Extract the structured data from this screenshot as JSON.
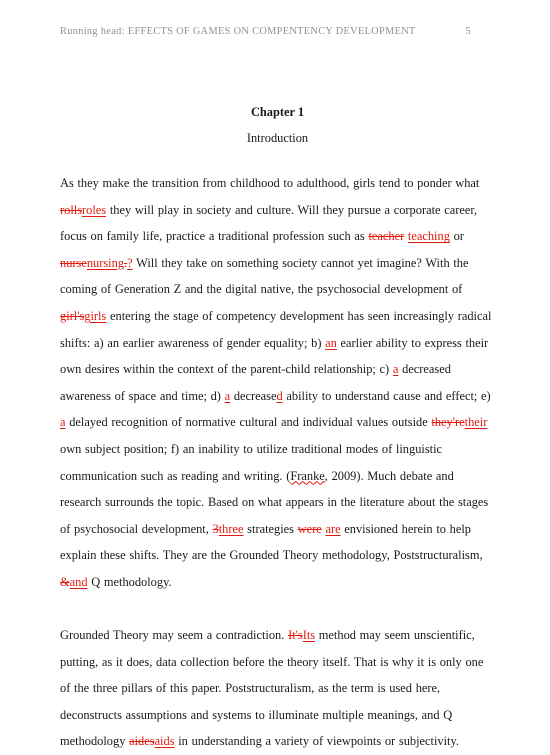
{
  "document": {
    "running_head": "Running head: EFFECTS OF GAMES ON COMPENTENCY DEVELOPMENT",
    "page_number": "5",
    "chapter_heading": "Chapter 1",
    "section_heading": "Introduction",
    "colors": {
      "text": "#1a1a1a",
      "header": "#8e9099",
      "revision": "#e01b10",
      "page_background": "#ffffff"
    }
  },
  "paragraph_1": {
    "t1": "As they make the transition from childhood to adulthood, girls tend to ponder what ",
    "del1": "rolls",
    "ins1": "roles",
    "t2": " they will play in society and culture.  Will they pursue a corporate career, focus on family life, practice a traditional profession such as ",
    "del2": "teacher",
    "ins2": "teaching",
    "t3": " or ",
    "del3": "nurse",
    "ins3": "nursing",
    "del4": ".",
    "ins4": "?",
    "t4": " Will they take on something society cannot yet imagine?  With the coming of Generation Z and the digital native, the psychosocial development of ",
    "del5": "girl's",
    "ins5": "girls",
    "t5": " entering the stage of competency development has seen increasingly radical shifts: a) an earlier awareness of gender equality; b) ",
    "ins6": "an",
    "t6": " earlier ability to express their own desires within the context of the parent-child relationship;  c) ",
    "ins7": "a",
    "t7": " decreased awareness of space and time; d) ",
    "ins8": "a",
    "t8": " decrease",
    "ins9": "d",
    "t9": " ability to understand cause and effect; e) ",
    "ins10": "a",
    "t10": " delayed recognition of normative cultural and individual values outside ",
    "del6": "they're",
    "ins11": "their",
    "t11": " own subject position; f) an inability to utilize traditional modes of linguistic communication such as reading and writing. (",
    "spell1": "Franke",
    "t12": ", 2009).  Much debate and research surrounds the topic.  Based on what appears in the literature about the stages of psychosocial development, ",
    "del7": "3",
    "ins12": "three",
    "t13": " strategies ",
    "del8": "were",
    "ins13": "are",
    "t14": " envisioned herein to help explain these shifts. They are the Grounded Theory methodology, Poststructuralism, ",
    "del9": "&",
    "ins14": "and",
    "t15": " Q methodology."
  },
  "paragraph_2": {
    "t1": "Grounded Theory may seem a contradiction. ",
    "del1": "It's",
    "ins1": "Its",
    "t2": " method may seem unscientific, putting, as it does, data collection before the theory itself. That is why it is only one of the three pillars of this paper.  Poststructuralism, as the term is used here, deconstructs assumptions and systems to illuminate multiple meanings, and Q methodology ",
    "del2": "aides",
    "ins2": "aids",
    "t3": " in understanding a variety of viewpoints or subjectivity."
  }
}
